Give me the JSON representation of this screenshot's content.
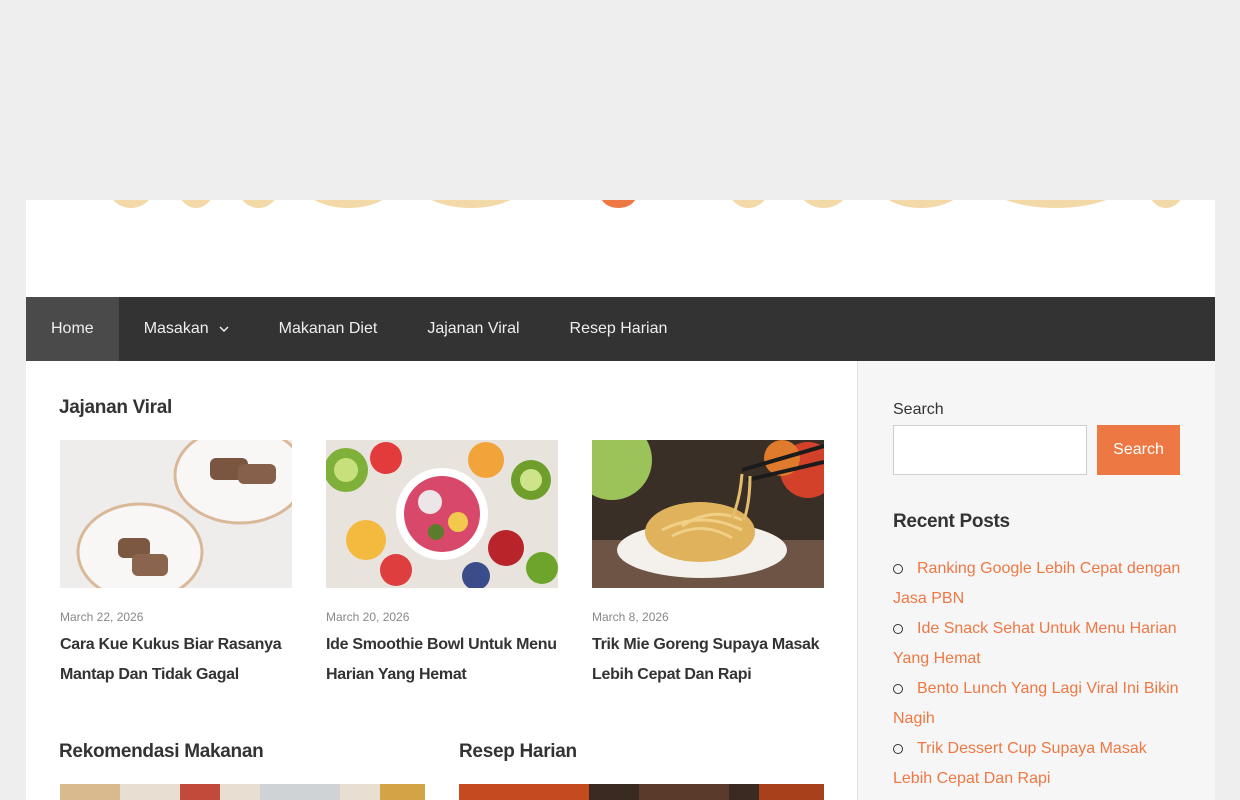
{
  "nav": {
    "items": [
      {
        "label": "Home",
        "active": true,
        "has_dropdown": false
      },
      {
        "label": "Masakan",
        "active": false,
        "has_dropdown": true
      },
      {
        "label": "Makanan Diet",
        "active": false,
        "has_dropdown": false
      },
      {
        "label": "Jajanan Viral",
        "active": false,
        "has_dropdown": false
      },
      {
        "label": "Resep Harian",
        "active": false,
        "has_dropdown": false
      }
    ],
    "dropdown_icon": "chevron-down-icon"
  },
  "main": {
    "section_title": "Jajanan Viral",
    "cards": [
      {
        "date": "March 22, 2026",
        "title": "Cara Kue Kukus Biar Rasanya Mantap Dan Tidak Gagal",
        "image": "cake-slices-on-plates"
      },
      {
        "date": "March 20, 2026",
        "title": "Ide Smoothie Bowl Untuk Menu Harian Yang Hemat",
        "image": "smoothie-bowl-with-fruits"
      },
      {
        "date": "March 8, 2026",
        "title": "Trik Mie Goreng Supaya Masak Lebih Cepat Dan Rapi",
        "image": "fried-noodles-with-chopsticks"
      }
    ],
    "bottom_sections": [
      {
        "title": "Rekomendasi Makanan"
      },
      {
        "title": "Resep Harian"
      }
    ]
  },
  "sidebar": {
    "search_label": "Search",
    "search_placeholder": "",
    "search_button": "Search",
    "recent_heading": "Recent Posts",
    "recent_posts": [
      "Ranking Google Lebih Cepat dengan Jasa PBN",
      "Ide Snack Sehat Untuk Menu Harian Yang Hemat",
      "Bento Lunch Yang Lagi Viral Ini Bikin Nagih",
      "Trik Dessert Cup Supaya Masak Lebih Cepat Dan Rapi"
    ]
  },
  "colors": {
    "accent": "#ee7844",
    "nav_bg": "#333333",
    "nav_active": "#4a4a4a",
    "page_bg": "#eeeeee"
  }
}
